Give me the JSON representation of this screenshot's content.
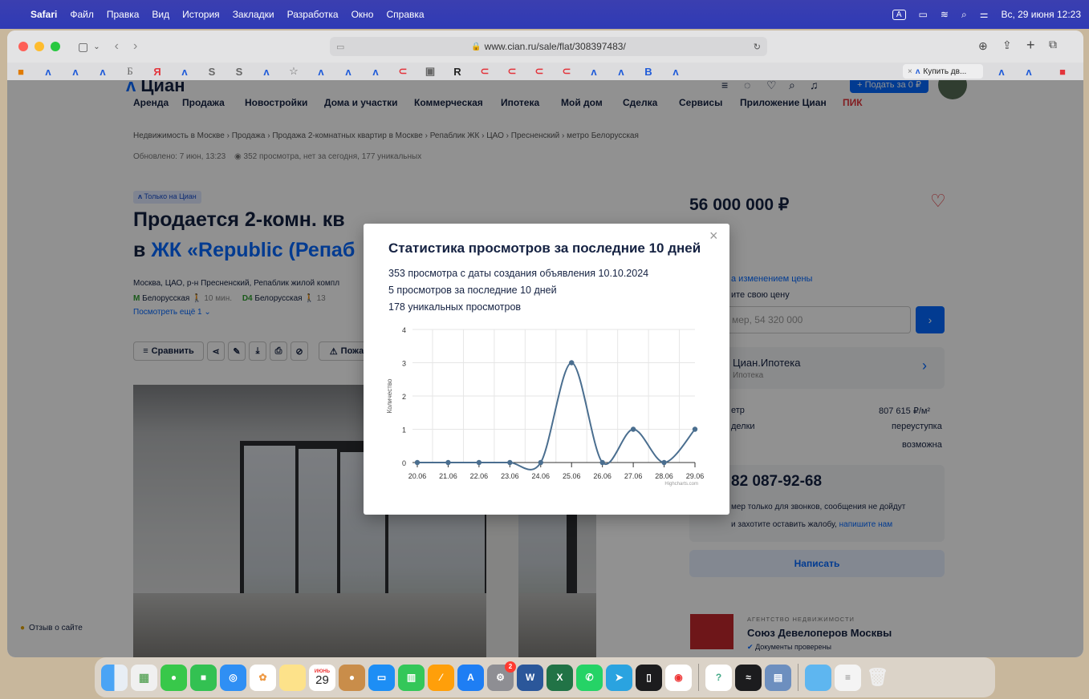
{
  "menubar": {
    "app": "Safari",
    "items": [
      "Файл",
      "Правка",
      "Вид",
      "История",
      "Закладки",
      "Разработка",
      "Окно",
      "Справка"
    ],
    "kbd": "A",
    "datetime": "Вс, 29 июня 12:23"
  },
  "browser": {
    "url": "www.cian.ru/sale/flat/308397483/",
    "favorites": [
      "Б",
      "Я",
      "S",
      "S",
      "R",
      "B"
    ],
    "active_tab": "Купить дв..."
  },
  "site": {
    "logo": "Циан",
    "post_button": "+ Подать за 0 ₽",
    "nav": [
      "Аренда",
      "Продажа",
      "Новостройки",
      "Дома и участки",
      "Коммерческая",
      "Ипотека",
      "Мой дом",
      "Сделка",
      "Сервисы",
      "Приложение Циан",
      "ПИК"
    ],
    "breadcrumbs": "Недвижимость в Москве  ›  Продажа  ›  Продажа 2-комнатных квартир в Москве  ›  Репаблик ЖК  ›  ЦАО  ›  Пресненский  ›  метро Белорусская",
    "updated": "Обновлено: 7 июн, 13:23",
    "views_summary": "352 просмотра, нет за сегодня, 177 уникальных",
    "badge": "Только на Циан",
    "title_line1": "Продается 2-комн. кв",
    "title_line2_prefix": "в ",
    "title_line2_link": "ЖК «Republic (Репаб",
    "address": "Москва, ЦАО, р-н Пресненский, Репаблик жилой компл",
    "metro1": "Белорусская",
    "metro1_time": "10 мин.",
    "metro2": "Белорусская",
    "metro2_time": "13",
    "more_link": "Посмотреть ещё 1",
    "compare_button": "Сравнить",
    "complain_button": "Пожа"
  },
  "aside": {
    "price": "56 000 000 ₽",
    "watch_price": "а изменением цены",
    "offer_price": "ите свою цену",
    "price_placeholder": "мер, 54 320 000",
    "mortgage_title": "Циан.Ипотека",
    "mortgage_sub": "Ипотека",
    "rows": [
      {
        "label": "етр",
        "value": "807 615 ₽/м²"
      },
      {
        "label": "делки",
        "value": "переуступка"
      },
      {
        "label": "",
        "value": "возможна"
      }
    ],
    "phone": "82 087-92-68",
    "phone_note1": "мер только для звонков, сообщения не дойдут",
    "phone_note2": "и захотите оставить жалобу, ",
    "phone_note_link": "напишите нам",
    "write_button": "Написать",
    "agency_type": "АГЕНТСТВО НЕДВИЖИМОСТИ",
    "agency_name": "Союз Девелоперов Москвы",
    "agency_verified": "Документы проверены"
  },
  "feedback": "Отзыв о сайте",
  "modal": {
    "title": "Статистика просмотров за последние 10 дней",
    "line1": "353 просмотра с даты создания объявления 10.10.2024",
    "line2": "5 просмотров за последние 10 дней",
    "line3": "178 уникальных просмотров",
    "close": "×"
  },
  "chart_data": {
    "type": "line",
    "x": [
      "20.06",
      "21.06",
      "22.06",
      "23.06",
      "24.06",
      "25.06",
      "26.06",
      "27.06",
      "28.06",
      "29.06"
    ],
    "series": [
      {
        "values": [
          0,
          0,
          0,
          0,
          0,
          3,
          0,
          1,
          0,
          1
        ]
      }
    ],
    "ylabel": "Количество",
    "ylim": [
      0,
      4
    ],
    "yticks": [
      0,
      1,
      2,
      3,
      4
    ],
    "credit": "Highcharts.com",
    "color": "#4a6e8f",
    "grid": true
  },
  "dock": {
    "calendar_month": "ИЮНЬ",
    "calendar_day": "29",
    "badge": "2"
  }
}
